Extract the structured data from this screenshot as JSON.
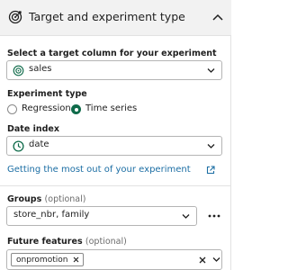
{
  "header": {
    "title": "Target and experiment type"
  },
  "target": {
    "label": "Select a target column for your experiment",
    "value": "sales"
  },
  "experiment_type": {
    "label": "Experiment type",
    "options": [
      "Regression",
      "Time series"
    ],
    "selected": "Time series"
  },
  "date_index": {
    "label": "Date index",
    "value": "date"
  },
  "help_link": "Getting the most out of your experiment",
  "groups": {
    "label": "Groups",
    "optional": "(optional)",
    "value": "store_nbr, family"
  },
  "future_features": {
    "label": "Future features",
    "optional": "(optional)",
    "chips": [
      "onpromotion"
    ]
  },
  "colors": {
    "accent": "#0f6b4a",
    "link": "#1c6ea4",
    "header_bg": "#f2f2f2"
  },
  "icons": [
    "target-icon",
    "chevron-up-icon",
    "chevron-down-icon",
    "clock-icon",
    "external-link-icon",
    "more-icon",
    "close-icon"
  ]
}
